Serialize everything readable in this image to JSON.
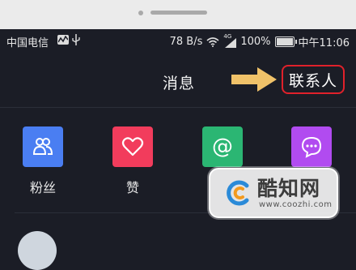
{
  "status_bar": {
    "carrier": "中国电信",
    "speed": "78 B/s",
    "network_badge": "4G",
    "battery_percent": "100%",
    "time": "中午11:06",
    "icons": [
      "activity-icon",
      "usb-icon",
      "wifi-icon",
      "signal-icon",
      "battery-icon"
    ]
  },
  "header": {
    "tabs": [
      {
        "label": "消息",
        "selected": false
      },
      {
        "label": "联系人",
        "selected": true
      }
    ],
    "highlight_color": "#e0212b",
    "arrow_color": "#f0c269"
  },
  "quick_actions": [
    {
      "label": "粉丝",
      "icon": "people-icon",
      "color": "#4a7ef2"
    },
    {
      "label": "赞",
      "icon": "heart-icon",
      "color": "#f23c5c"
    },
    {
      "label": "@",
      "icon": "at-icon",
      "color": "#2bb673"
    },
    {
      "label": "",
      "icon": "chat-bubble-icon",
      "color": "#b14bf0"
    }
  ],
  "watermark": {
    "brand": "酷知网",
    "url": "www.coozhi.com"
  }
}
